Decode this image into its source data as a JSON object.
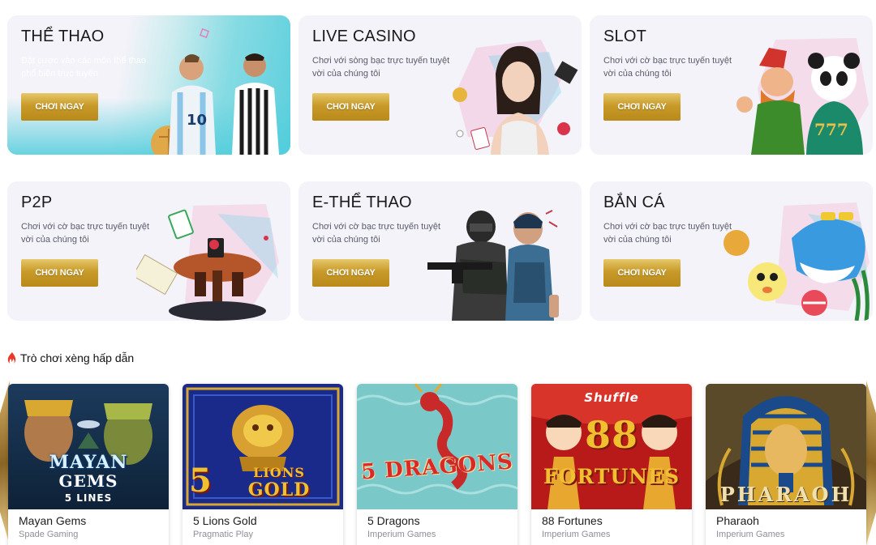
{
  "categories": [
    {
      "id": "sport",
      "title": "THỂ THAO",
      "desc": "Đặt cược vào các môn thể thao phổ biến trực tuyến",
      "button": "CHƠI NGAY"
    },
    {
      "id": "casino",
      "title": "LIVE CASINO",
      "desc": "Chơi với sòng bạc trực tuyến tuyệt vời của chúng tôi",
      "button": "CHƠI NGAY"
    },
    {
      "id": "slot",
      "title": "SLOT",
      "desc": "Chơi với cờ bạc trực tuyến tuyệt vời của chúng tôi",
      "button": "CHƠI NGAY"
    },
    {
      "id": "p2p",
      "title": "P2P",
      "desc": "Chơi với cờ bạc trực tuyến tuyệt vời của chúng tôi",
      "button": "CHƠI NGAY"
    },
    {
      "id": "esport",
      "title": "E-THỂ THAO",
      "desc": "Chơi với cờ bạc trực tuyến tuyệt vời của chúng tôi",
      "button": "CHƠI NGAY"
    },
    {
      "id": "fish",
      "title": "BẮN CÁ",
      "desc": "Chơi với cờ bạc trực tuyến tuyệt vời của chúng tôi",
      "button": "CHƠI NGAY"
    }
  ],
  "section": {
    "title": "Trò chơi xèng hấp dẫn",
    "icon": "fire-icon"
  },
  "games": [
    {
      "name": "Mayan Gems",
      "provider": "Spade Gaming",
      "thumb_lines": [
        "MAYAN",
        "GEMS",
        "5 LINES"
      ]
    },
    {
      "name": "5 Lions Gold",
      "provider": "Pragmatic Play",
      "thumb_lines": [
        "5",
        "LIONS",
        "GOLD"
      ]
    },
    {
      "name": "5 Dragons",
      "provider": "Imperium Games",
      "thumb_lines": [
        "5 DRAGONS"
      ]
    },
    {
      "name": "88 Fortunes",
      "provider": "Imperium Games",
      "thumb_lines": [
        "Shuffle",
        "88",
        "FORTUNES"
      ]
    },
    {
      "name": "Pharaoh",
      "provider": "Imperium Games",
      "thumb_lines": [
        "PHARAOH"
      ]
    }
  ],
  "colors": {
    "card_bg": "#f3f3f9",
    "button_gold": "#c89a28",
    "sport_teal": "#5ccfdd"
  }
}
